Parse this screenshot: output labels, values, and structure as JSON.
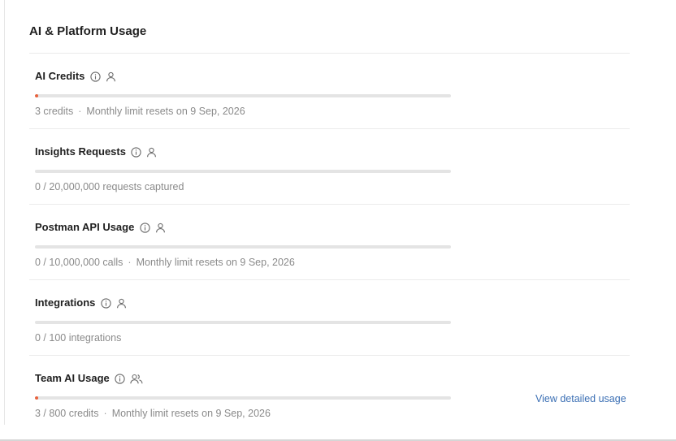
{
  "section": {
    "title": "AI & Platform Usage"
  },
  "items": [
    {
      "title": "AI Credits",
      "icons": [
        "info-icon",
        "user-icon"
      ],
      "progress": 0.007,
      "usage_text": "3 credits",
      "reset_text": "Monthly limit resets on 9 Sep, 2026"
    },
    {
      "title": "Insights Requests",
      "icons": [
        "info-icon",
        "user-icon"
      ],
      "progress": 0,
      "usage_text": "0 / 20,000,000 requests captured",
      "reset_text": ""
    },
    {
      "title": "Postman API Usage",
      "icons": [
        "info-icon",
        "user-icon"
      ],
      "progress": 0,
      "usage_text": "0 / 10,000,000 calls",
      "reset_text": "Monthly limit resets on 9 Sep, 2026"
    },
    {
      "title": "Integrations",
      "icons": [
        "info-icon",
        "user-icon"
      ],
      "progress": 0,
      "usage_text": "0 / 100 integrations",
      "reset_text": ""
    },
    {
      "title": "Team AI Usage",
      "icons": [
        "info-icon",
        "team-icon"
      ],
      "progress": 0.00375,
      "usage_text": "3 / 800 credits",
      "reset_text": "Monthly limit resets on 9 Sep, 2026"
    }
  ],
  "links": {
    "view_detailed_usage": "View detailed usage"
  },
  "meta_separator": "·",
  "colors": {
    "accent": "#e8613c",
    "link": "#3b6fb4",
    "track": "#e4e4e4",
    "muted_text": "#8a8a8a"
  }
}
